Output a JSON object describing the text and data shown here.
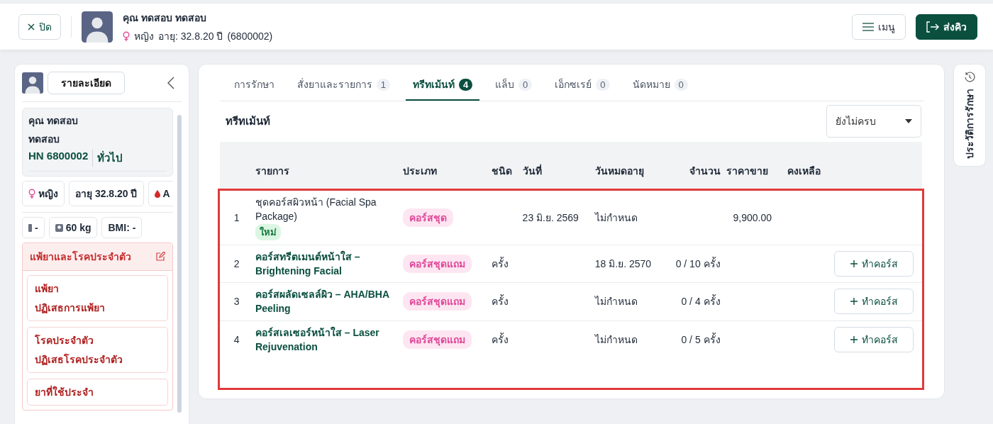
{
  "header": {
    "close_button": "ปิด",
    "patient_name": "คุณ ทดสอบ ทดสอบ",
    "gender": "หญิง",
    "age": "อายุ: 32.8.20 ปี",
    "hn": "(6800002)",
    "menu_button": "เมนู",
    "send_button": "ส่งคิว"
  },
  "sidebar": {
    "details_button": "รายละเอียด",
    "name_line_1": "คุณ ทดสอบ",
    "name_line_2": "ทดสอบ",
    "hn": "HN 6800002",
    "patient_type": "ทั่วไป",
    "chips": [
      {
        "kind": "gender",
        "text": "หญิง"
      },
      {
        "kind": "plain",
        "text": "อายุ 32.8.20 ปี"
      },
      {
        "kind": "blood",
        "text": "A"
      }
    ],
    "measures": [
      {
        "kind": "height",
        "text": "-"
      },
      {
        "kind": "weight",
        "text": "60 kg"
      },
      {
        "kind": "plain",
        "text": "BMI: -"
      }
    ],
    "allergy_panel": {
      "title": "แพ้ยาและโรคประจำตัว",
      "items": [
        {
          "label": "แพ้ยา",
          "value": "ปฏิเสธการแพ้ยา"
        },
        {
          "label": "โรคประจำตัว",
          "value": "ปฏิเสธโรคประจำตัว"
        },
        {
          "label": "ยาที่ใช้ประจำ"
        }
      ]
    }
  },
  "tabs": [
    {
      "label": "การรักษา",
      "selected": false
    },
    {
      "label": "สั่งยาและรายการ",
      "count": "1",
      "selected": false
    },
    {
      "label": "ทรีทเม้นท์",
      "count": "4",
      "selected": true
    },
    {
      "label": "แล็บ",
      "count": "0",
      "selected": false
    },
    {
      "label": "เอ็กซเรย์",
      "count": "0",
      "selected": false
    },
    {
      "label": "นัดหมาย",
      "count": "0",
      "selected": false
    }
  ],
  "section_title": "ทรีทเม้นท์",
  "filter": {
    "value": "ยังไม่ครบ"
  },
  "table": {
    "columns": [
      "รายการ",
      "ประเภท",
      "ชนิด",
      "วันที่",
      "วันหมดอายุ",
      "จำนวน",
      "ราคาขาย",
      "คงเหลือ"
    ],
    "rows": [
      {
        "kind": "course",
        "no": "1",
        "name": "ชุดคอร์สผิวหน้า (Facial Spa Package)",
        "badge": "ใหม่",
        "type": "คอร์สชุด",
        "date": "23 มิ.ย. 2569",
        "expiry": "ไม่กำหนด",
        "price": "9,900.00"
      },
      {
        "kind": "bonus",
        "no": "2",
        "name": "คอร์สทรีตเมนต์หน้าใส – Brightening Facial",
        "type": "คอร์สชุดแถม",
        "unit": "ครั้ง",
        "expiry": "18 มิ.ย. 2570",
        "quantity": "0 / 10 ครั้ง",
        "action": "ทำคอร์ส"
      },
      {
        "kind": "bonus",
        "no": "3",
        "name": "คอร์สผลัดเซลล์ผิว – AHA/BHA Peeling",
        "type": "คอร์สชุดแถม",
        "unit": "ครั้ง",
        "expiry": "ไม่กำหนด",
        "quantity": "0 / 4 ครั้ง",
        "action": "ทำคอร์ส"
      },
      {
        "kind": "bonus",
        "no": "4",
        "name": "คอร์สเลเซอร์หน้าใส – Laser Rejuvenation",
        "type": "คอร์สชุดแถม",
        "unit": "ครั้ง",
        "expiry": "ไม่กำหนด",
        "quantity": "0 / 5 ครั้ง",
        "action": "ทำคอร์ส"
      }
    ]
  },
  "history_tab": "ประวัติการรักษา"
}
